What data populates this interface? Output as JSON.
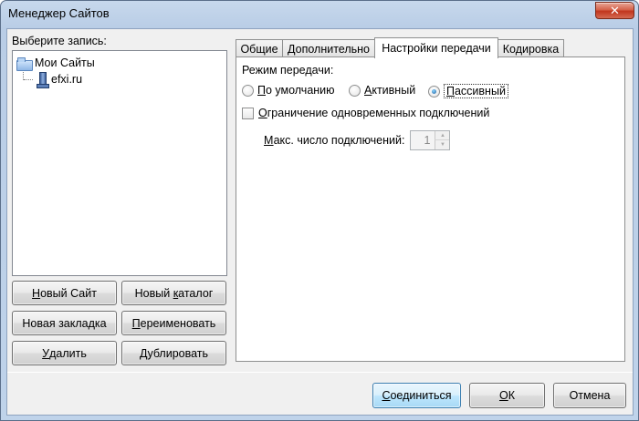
{
  "window": {
    "title": "Менеджер Сайтов",
    "close_glyph": "✕"
  },
  "sidebar": {
    "label": "Выберите запись:",
    "tree": {
      "root": {
        "label": "Мои Сайты",
        "icon": "folder-icon"
      },
      "child": {
        "label": "efxi.ru",
        "icon": "server-icon"
      }
    },
    "buttons": {
      "new_site": {
        "u": "Н",
        "rest": "овый Сайт"
      },
      "new_folder": {
        "pre": "Новый ",
        "u": "к",
        "rest": "аталог"
      },
      "new_bookmark": {
        "label": "Новая закладка"
      },
      "rename": {
        "u": "П",
        "rest": "ереименовать"
      },
      "delete": {
        "u": "У",
        "rest": "далить"
      },
      "duplicate": {
        "u": "Д",
        "rest": "ублировать"
      }
    }
  },
  "tabs": [
    {
      "label": "Общие",
      "active": false
    },
    {
      "label": "Дополнительно",
      "active": false
    },
    {
      "label": "Настройки передачи",
      "active": true
    },
    {
      "label": "Кодировка",
      "active": false
    }
  ],
  "transfer": {
    "mode_label": "Режим передачи:",
    "modes": {
      "default": {
        "u": "П",
        "rest": "о умолчанию",
        "checked": false
      },
      "active": {
        "u": "А",
        "rest": "ктивный",
        "checked": false
      },
      "passive": {
        "u": "П",
        "rest": "ассивный",
        "checked": true
      }
    },
    "limit_checkbox": {
      "u": "О",
      "rest": "граничение одновременных подключений",
      "checked": false
    },
    "max_connections": {
      "u": "М",
      "rest": "акс. число подключений:",
      "value": "1",
      "up_glyph": "▲",
      "down_glyph": "▼"
    }
  },
  "footer": {
    "connect": {
      "u": "С",
      "rest": "оединиться"
    },
    "ok": {
      "u": "О",
      "rest": "К"
    },
    "cancel": {
      "label": "Отмена"
    }
  }
}
